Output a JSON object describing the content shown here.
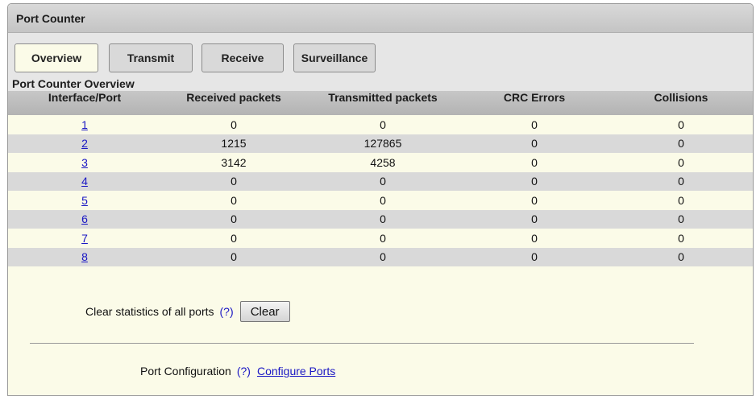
{
  "panel": {
    "title": "Port Counter"
  },
  "tabs": [
    {
      "label": "Overview",
      "active": true
    },
    {
      "label": "Transmit",
      "active": false
    },
    {
      "label": "Receive",
      "active": false
    },
    {
      "label": "Surveillance",
      "active": false
    }
  ],
  "overview": {
    "title": "Port Counter Overview",
    "columns": [
      "Interface/Port",
      "Received packets",
      "Transmitted packets",
      "CRC Errors",
      "Collisions"
    ],
    "rows": [
      {
        "port": "1",
        "received": "0",
        "transmitted": "0",
        "crc": "0",
        "collisions": "0"
      },
      {
        "port": "2",
        "received": "1215",
        "transmitted": "127865",
        "crc": "0",
        "collisions": "0"
      },
      {
        "port": "3",
        "received": "3142",
        "transmitted": "4258",
        "crc": "0",
        "collisions": "0"
      },
      {
        "port": "4",
        "received": "0",
        "transmitted": "0",
        "crc": "0",
        "collisions": "0"
      },
      {
        "port": "5",
        "received": "0",
        "transmitted": "0",
        "crc": "0",
        "collisions": "0"
      },
      {
        "port": "6",
        "received": "0",
        "transmitted": "0",
        "crc": "0",
        "collisions": "0"
      },
      {
        "port": "7",
        "received": "0",
        "transmitted": "0",
        "crc": "0",
        "collisions": "0"
      },
      {
        "port": "8",
        "received": "0",
        "transmitted": "0",
        "crc": "0",
        "collisions": "0"
      }
    ]
  },
  "clear": {
    "label": "Clear statistics of all ports",
    "help": "(?)",
    "button": "Clear"
  },
  "config": {
    "label": "Port Configuration",
    "help": "(?)",
    "link": "Configure Ports"
  },
  "colors": {
    "link": "#1a17c4",
    "panel_bg": "#fbfbe8",
    "row_alt": "#d9d9d9"
  }
}
